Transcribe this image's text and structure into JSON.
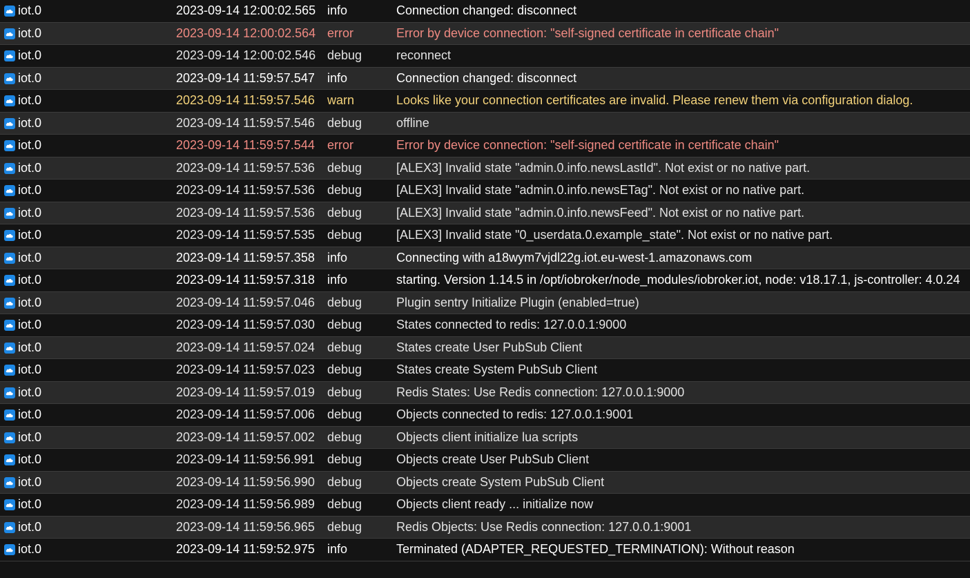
{
  "icons": {
    "adapter": "iot-cloud-icon"
  },
  "colors": {
    "background_odd": "#141414",
    "background_even": "#2a2a2a",
    "error": "#f08a82",
    "warn": "#f3d27a",
    "info": "#ffffff",
    "debug": "#e2e2e2",
    "icon_blue": "#1e88e5"
  },
  "log": {
    "rows": [
      {
        "source": "iot.0",
        "time": "2023-09-14 12:00:02.565",
        "severity": "info",
        "message": "Connection changed: disconnect"
      },
      {
        "source": "iot.0",
        "time": "2023-09-14 12:00:02.564",
        "severity": "error",
        "message": "Error by device connection: \"self-signed certificate in certificate chain\""
      },
      {
        "source": "iot.0",
        "time": "2023-09-14 12:00:02.546",
        "severity": "debug",
        "message": "reconnect"
      },
      {
        "source": "iot.0",
        "time": "2023-09-14 11:59:57.547",
        "severity": "info",
        "message": "Connection changed: disconnect"
      },
      {
        "source": "iot.0",
        "time": "2023-09-14 11:59:57.546",
        "severity": "warn",
        "message": "Looks like your connection certificates are invalid. Please renew them via configuration dialog."
      },
      {
        "source": "iot.0",
        "time": "2023-09-14 11:59:57.546",
        "severity": "debug",
        "message": "offline"
      },
      {
        "source": "iot.0",
        "time": "2023-09-14 11:59:57.544",
        "severity": "error",
        "message": "Error by device connection: \"self-signed certificate in certificate chain\""
      },
      {
        "source": "iot.0",
        "time": "2023-09-14 11:59:57.536",
        "severity": "debug",
        "message": "[ALEX3] Invalid state \"admin.0.info.newsLastId\". Not exist or no native part."
      },
      {
        "source": "iot.0",
        "time": "2023-09-14 11:59:57.536",
        "severity": "debug",
        "message": "[ALEX3] Invalid state \"admin.0.info.newsETag\". Not exist or no native part."
      },
      {
        "source": "iot.0",
        "time": "2023-09-14 11:59:57.536",
        "severity": "debug",
        "message": "[ALEX3] Invalid state \"admin.0.info.newsFeed\". Not exist or no native part."
      },
      {
        "source": "iot.0",
        "time": "2023-09-14 11:59:57.535",
        "severity": "debug",
        "message": "[ALEX3] Invalid state \"0_userdata.0.example_state\". Not exist or no native part."
      },
      {
        "source": "iot.0",
        "time": "2023-09-14 11:59:57.358",
        "severity": "info",
        "message": "Connecting with a18wym7vjdl22g.iot.eu-west-1.amazonaws.com"
      },
      {
        "source": "iot.0",
        "time": "2023-09-14 11:59:57.318",
        "severity": "info",
        "message": "starting. Version 1.14.5 in /opt/iobroker/node_modules/iobroker.iot, node: v18.17.1, js-controller: 4.0.24"
      },
      {
        "source": "iot.0",
        "time": "2023-09-14 11:59:57.046",
        "severity": "debug",
        "message": "Plugin sentry Initialize Plugin (enabled=true)"
      },
      {
        "source": "iot.0",
        "time": "2023-09-14 11:59:57.030",
        "severity": "debug",
        "message": "States connected to redis: 127.0.0.1:9000"
      },
      {
        "source": "iot.0",
        "time": "2023-09-14 11:59:57.024",
        "severity": "debug",
        "message": "States create User PubSub Client"
      },
      {
        "source": "iot.0",
        "time": "2023-09-14 11:59:57.023",
        "severity": "debug",
        "message": "States create System PubSub Client"
      },
      {
        "source": "iot.0",
        "time": "2023-09-14 11:59:57.019",
        "severity": "debug",
        "message": "Redis States: Use Redis connection: 127.0.0.1:9000"
      },
      {
        "source": "iot.0",
        "time": "2023-09-14 11:59:57.006",
        "severity": "debug",
        "message": "Objects connected to redis: 127.0.0.1:9001"
      },
      {
        "source": "iot.0",
        "time": "2023-09-14 11:59:57.002",
        "severity": "debug",
        "message": "Objects client initialize lua scripts"
      },
      {
        "source": "iot.0",
        "time": "2023-09-14 11:59:56.991",
        "severity": "debug",
        "message": "Objects create User PubSub Client"
      },
      {
        "source": "iot.0",
        "time": "2023-09-14 11:59:56.990",
        "severity": "debug",
        "message": "Objects create System PubSub Client"
      },
      {
        "source": "iot.0",
        "time": "2023-09-14 11:59:56.989",
        "severity": "debug",
        "message": "Objects client ready ... initialize now"
      },
      {
        "source": "iot.0",
        "time": "2023-09-14 11:59:56.965",
        "severity": "debug",
        "message": "Redis Objects: Use Redis connection: 127.0.0.1:9001"
      },
      {
        "source": "iot.0",
        "time": "2023-09-14 11:59:52.975",
        "severity": "info",
        "message": "Terminated (ADAPTER_REQUESTED_TERMINATION): Without reason"
      }
    ]
  }
}
